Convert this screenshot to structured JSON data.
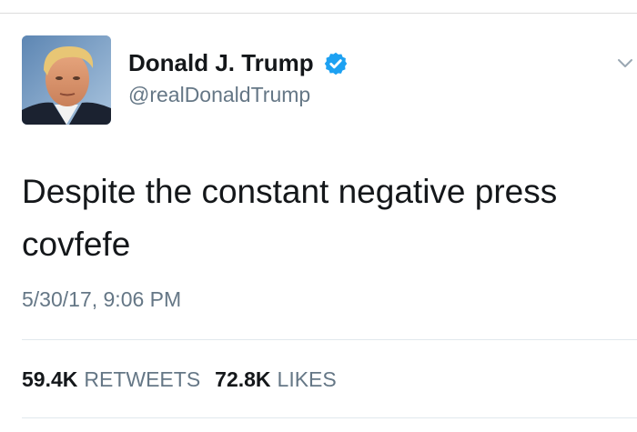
{
  "user": {
    "display_name": "Donald J. Trump",
    "handle": "@realDonaldTrump",
    "verified_icon": "verified-badge-icon",
    "avatar": "profile-photo"
  },
  "tweet": {
    "text_lines": [
      "Despite the constant negative press",
      "covfefe"
    ],
    "timestamp": "5/30/17, 9:06 PM"
  },
  "stats": {
    "retweets_count": "59.4K",
    "retweets_label": "RETWEETS",
    "likes_count": "72.8K",
    "likes_label": "LIKES"
  },
  "menu": {
    "caret_icon": "chevron-down-icon"
  },
  "colors": {
    "verified": "#1da1f2",
    "secondary_text": "#657786",
    "primary_text": "#14171a"
  }
}
